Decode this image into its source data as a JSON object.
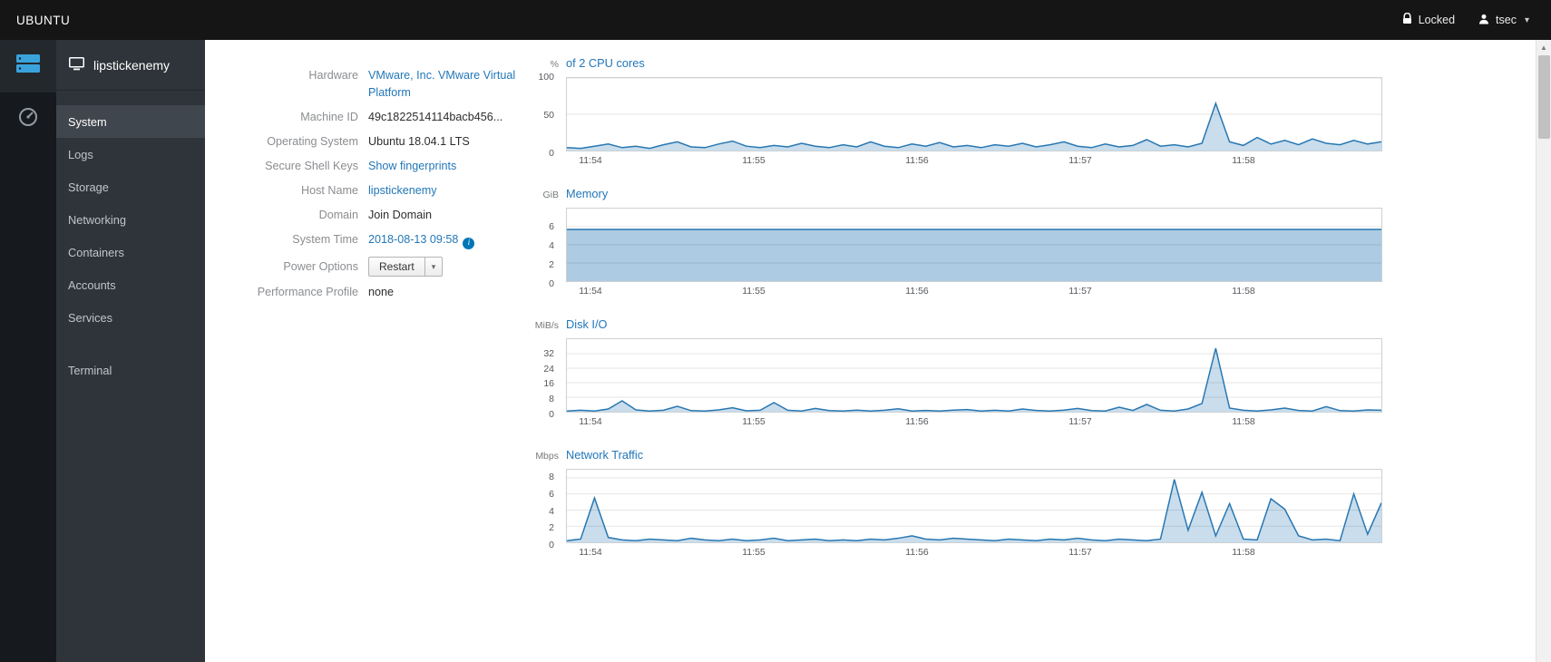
{
  "colors": {
    "topbar": "#151515",
    "sidebar": "#2f343a",
    "accent": "#2277b8",
    "chart_line": "#2877b2",
    "chart_fill": "rgba(40,119,178,0.25)",
    "memory_fill": "rgba(40,119,178,0.38)"
  },
  "topbar": {
    "brand": "UBUNTU",
    "locked_label": "Locked",
    "user": "tsec"
  },
  "sidebar": {
    "host": "lipstickenemy",
    "items": [
      {
        "label": "System",
        "active": true
      },
      {
        "label": "Logs"
      },
      {
        "label": "Storage"
      },
      {
        "label": "Networking"
      },
      {
        "label": "Containers"
      },
      {
        "label": "Accounts"
      },
      {
        "label": "Services"
      },
      {
        "label": "Terminal",
        "separated": true
      }
    ]
  },
  "system": {
    "rows": [
      {
        "label": "Hardware",
        "value": "VMware, Inc. VMware Virtual Platform"
      },
      {
        "label": "Machine ID",
        "value": "49c1822514114bacb456..."
      },
      {
        "label": "Operating System",
        "value": "Ubuntu 18.04.1 LTS"
      },
      {
        "label": "Secure Shell Keys",
        "value": "Show fingerprints"
      },
      {
        "label": "Host Name",
        "value": "lipstickenemy"
      },
      {
        "label": "Domain",
        "value": "Join Domain"
      },
      {
        "label": "System Time",
        "value": "2018-08-13 09:58"
      },
      {
        "label": "Power Options",
        "value": "Restart"
      },
      {
        "label": "Performance Profile",
        "value": "none"
      }
    ]
  },
  "chart_data": [
    {
      "type": "area",
      "unit": "%",
      "title": "of 2 CPU cores",
      "ylim": [
        0,
        100
      ],
      "yticks": [
        0,
        50,
        100
      ],
      "xticks": [
        "11:54",
        "11:55",
        "11:56",
        "11:57",
        "11:58"
      ],
      "values": [
        4,
        3,
        6,
        9,
        4,
        6,
        3,
        8,
        12,
        5,
        4,
        9,
        13,
        6,
        4,
        7,
        5,
        10,
        6,
        4,
        8,
        5,
        12,
        6,
        4,
        9,
        6,
        11,
        5,
        7,
        4,
        8,
        6,
        10,
        5,
        8,
        12,
        6,
        4,
        9,
        5,
        7,
        15,
        6,
        8,
        5,
        10,
        65,
        12,
        7,
        18,
        9,
        14,
        8,
        16,
        10,
        8,
        14,
        9,
        12
      ]
    },
    {
      "type": "area",
      "unit": "GiB",
      "title": "Memory",
      "ylim": [
        0,
        8
      ],
      "yticks": [
        0,
        2,
        4,
        6
      ],
      "xticks": [
        "11:54",
        "11:55",
        "11:56",
        "11:57",
        "11:58"
      ],
      "values": [
        5.7,
        5.7,
        5.7,
        5.7,
        5.7,
        5.7,
        5.7,
        5.7,
        5.7,
        5.7,
        5.7,
        5.7
      ]
    },
    {
      "type": "area",
      "unit": "MiB/s",
      "title": "Disk I/O",
      "ylim": [
        0,
        40
      ],
      "yticks": [
        0,
        8,
        16,
        24,
        32
      ],
      "xticks": [
        "11:54",
        "11:55",
        "11:56",
        "11:57",
        "11:58"
      ],
      "values": [
        0.4,
        0.8,
        0.4,
        1.5,
        6,
        1,
        0.4,
        0.8,
        3,
        0.6,
        0.4,
        1,
        2.2,
        0.5,
        0.8,
        5,
        0.8,
        0.4,
        1.8,
        0.6,
        0.4,
        0.9,
        0.4,
        0.8,
        1.6,
        0.4,
        0.7,
        0.4,
        0.9,
        1.2,
        0.4,
        0.8,
        0.4,
        1.5,
        0.7,
        0.4,
        0.9,
        1.8,
        0.6,
        0.4,
        2.5,
        0.7,
        4,
        0.8,
        0.4,
        1.5,
        4.5,
        35,
        2,
        0.8,
        0.4,
        1,
        2,
        0.7,
        0.4,
        2.8,
        0.6,
        0.4,
        1,
        0.8
      ]
    },
    {
      "type": "area",
      "unit": "Mbps",
      "title": "Network Traffic",
      "ylim": [
        0,
        9
      ],
      "yticks": [
        0,
        2,
        4,
        6,
        8
      ],
      "xticks": [
        "11:54",
        "11:55",
        "11:56",
        "11:57",
        "11:58"
      ],
      "values": [
        0.2,
        0.4,
        5.5,
        0.6,
        0.3,
        0.2,
        0.4,
        0.3,
        0.2,
        0.5,
        0.3,
        0.2,
        0.4,
        0.2,
        0.3,
        0.5,
        0.2,
        0.3,
        0.4,
        0.2,
        0.3,
        0.2,
        0.4,
        0.3,
        0.5,
        0.8,
        0.4,
        0.3,
        0.5,
        0.4,
        0.3,
        0.2,
        0.4,
        0.3,
        0.2,
        0.4,
        0.3,
        0.5,
        0.3,
        0.2,
        0.4,
        0.3,
        0.2,
        0.4,
        7.8,
        1.5,
        6.2,
        0.8,
        4.8,
        0.4,
        0.3,
        5.4,
        4.1,
        0.8,
        0.3,
        0.4,
        0.2,
        6,
        1,
        4.9
      ]
    }
  ]
}
